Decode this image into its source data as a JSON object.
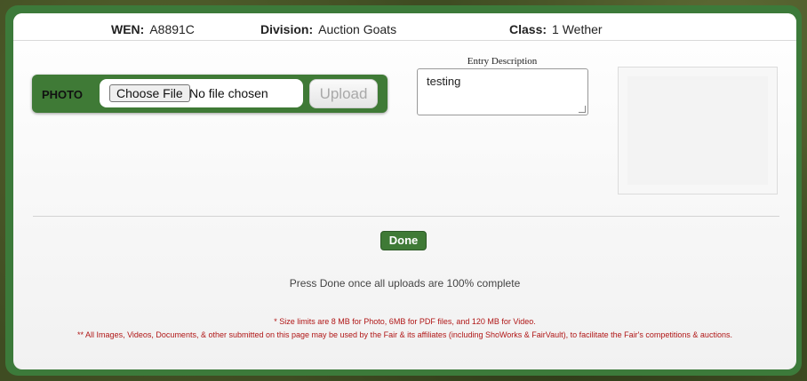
{
  "info": {
    "wen_label": "WEN:",
    "wen_value": "A8891C",
    "division_label": "Division:",
    "division_value": "Auction Goats",
    "class_label": "Class:",
    "class_value": "1 Wether"
  },
  "photo": {
    "label": "PHOTO",
    "choose_button": "Choose File",
    "file_status": "No file chosen",
    "upload_button": "Upload"
  },
  "description": {
    "label": "Entry Description",
    "value": "testing"
  },
  "actions": {
    "done_button": "Done",
    "note": "Press Done once all uploads are 100% complete"
  },
  "fine_print": {
    "size_limits": "* Size limits are 8 MB for Photo, 6MB for PDF files, and 120 MB for Video.",
    "usage": "** All Images, Videos, Documents, & other submitted on this page may be used by the Fair & its affiliates (including ShoWorks & FairVault), to facilitate the Fair's competitions & auctions."
  },
  "colors": {
    "accent_green": "#3f7a36",
    "warning_red": "#b01616"
  }
}
